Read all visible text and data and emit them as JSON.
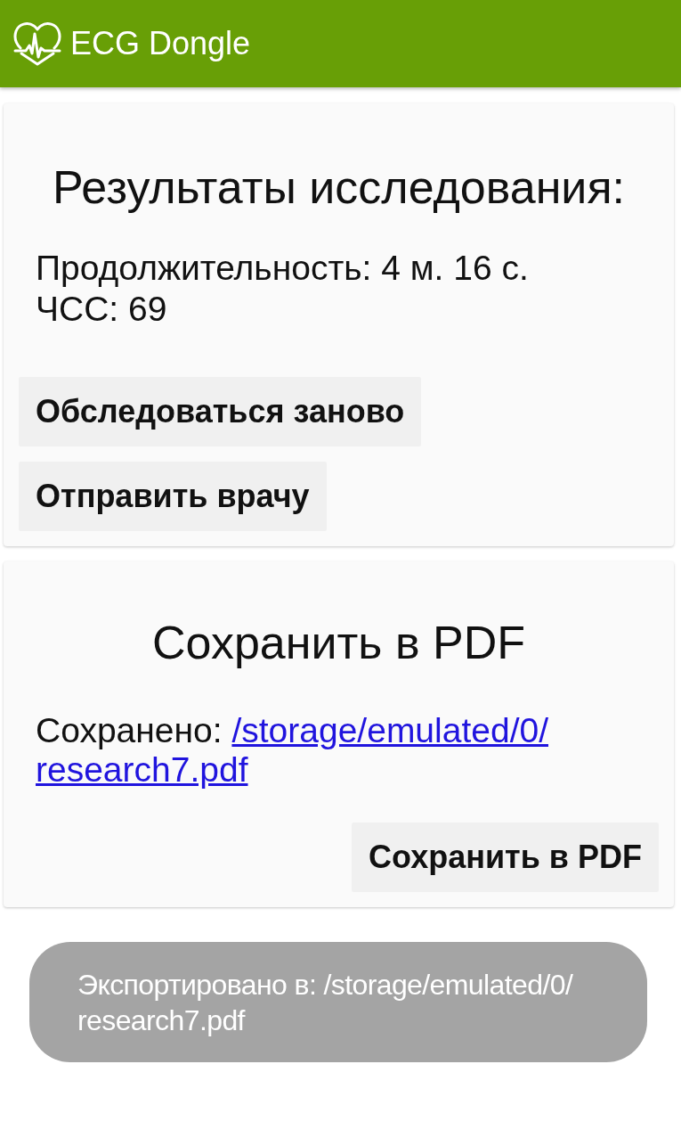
{
  "app_bar": {
    "title": "ECG Dongle"
  },
  "results_card": {
    "title": "Результаты исследования:",
    "lines": [
      "Продолжительность: 4 м. 16 с.",
      "ЧСС: 69"
    ],
    "buttons": [
      "Обследоваться заново",
      "Отправить врачу"
    ]
  },
  "pdf_card": {
    "title": "Сохранить в PDF",
    "saved_label": "Сохранено:",
    "saved_link_lines": [
      "/storage/emulated/0/",
      "research7.pdf"
    ],
    "button": "Сохранить в PDF"
  },
  "toast": {
    "lines": [
      "Экспортировано в: /storage/emulated/0/",
      "research7.pdf"
    ]
  }
}
